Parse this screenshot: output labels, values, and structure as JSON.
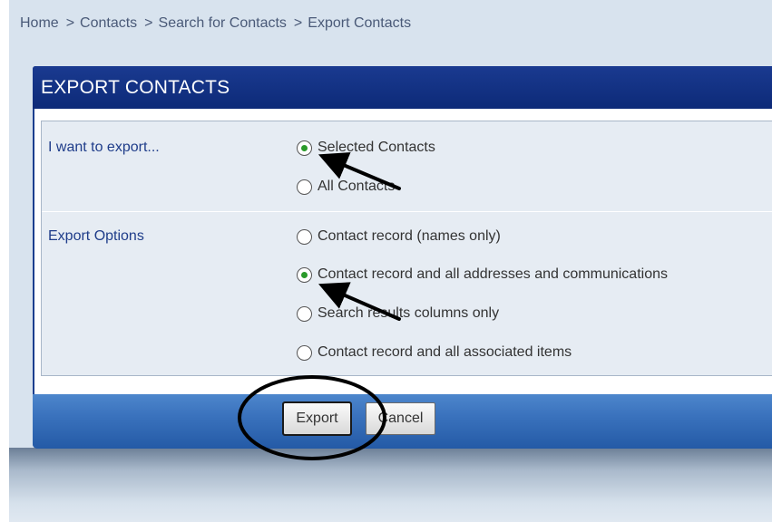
{
  "breadcrumb": {
    "items": [
      "Home",
      "Contacts",
      "Search for Contacts",
      "Export Contacts"
    ],
    "separator": ">"
  },
  "panel": {
    "title": "EXPORT CONTACTS"
  },
  "export_section": {
    "label": "I want to export...",
    "options": [
      {
        "label": "Selected Contacts",
        "checked": true
      },
      {
        "label": "All Contacts",
        "checked": false
      }
    ]
  },
  "options_section": {
    "label": "Export Options",
    "options": [
      {
        "label": "Contact record (names only)",
        "checked": false
      },
      {
        "label": "Contact record and all addresses and communications",
        "checked": true
      },
      {
        "label": "Search results columns only",
        "checked": false
      },
      {
        "label": "Contact record and all associated items",
        "checked": false
      }
    ]
  },
  "buttons": {
    "export_label": "Export",
    "cancel_label": "Cancel"
  },
  "colors": {
    "header_blue": "#0d2a78",
    "footer_blue": "#3a72bd",
    "label_blue": "#1f3d8a",
    "radio_selected": "#2a9a2a",
    "page_background": "#d8e3ee"
  },
  "annotations": {
    "arrows": 2,
    "circle_target": "export-button"
  }
}
